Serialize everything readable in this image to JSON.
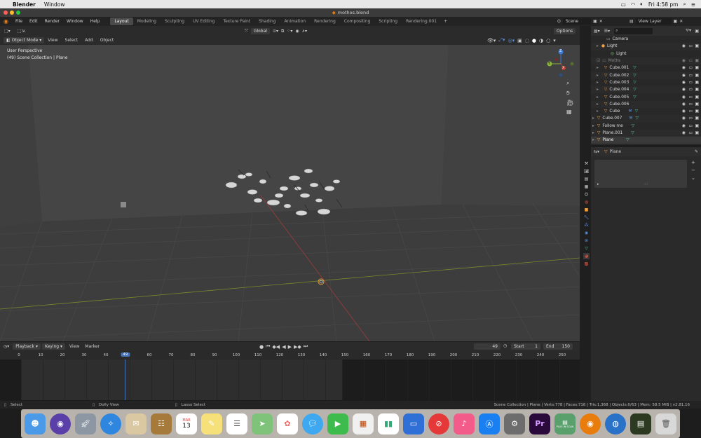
{
  "mac": {
    "apple_glyph": "",
    "app_name": "Blender",
    "menu_window": "Window",
    "clock": "Fri 4:58 pm"
  },
  "window": {
    "title": "mothos.blend"
  },
  "topbar": {
    "menus": [
      "File",
      "Edit",
      "Render",
      "Window",
      "Help"
    ],
    "workspaces": [
      "Layout",
      "Modeling",
      "Sculpting",
      "UV Editing",
      "Texture Paint",
      "Shading",
      "Animation",
      "Rendering",
      "Compositing",
      "Scripting",
      "Rendering.001"
    ],
    "active_workspace": "Layout",
    "scene": "Scene",
    "view_layer": "View Layer"
  },
  "toolheader": {
    "orientation": "Global",
    "options": "Options"
  },
  "viewport_header": {
    "mode": "Object Mode",
    "menus": [
      "View",
      "Select",
      "Add",
      "Object"
    ]
  },
  "viewport": {
    "perspective_label": "User Perspective",
    "collection_label": "(49) Scene Collection | Plane",
    "gizmo": {
      "x": "X",
      "y": "Y",
      "z": "Z"
    }
  },
  "outliner": {
    "rows": [
      "Camera",
      "Light",
      "Light",
      "Moths",
      "Cube.001",
      "Cube.002",
      "Cube.003",
      "Cube.004",
      "Cube.005",
      "Cube.006",
      "Cube",
      "Cube.007",
      "Follow me",
      "Plane.001",
      "Plane"
    ]
  },
  "properties": {
    "object_name": "Plane"
  },
  "timeline": {
    "menus": [
      "Playback",
      "Keying",
      "View",
      "Marker"
    ],
    "current_frame": "49",
    "start_label": "Start",
    "start": "1",
    "end_label": "End",
    "end": "150",
    "ruler_ticks": [
      "0",
      "10",
      "20",
      "30",
      "40",
      "49",
      "60",
      "70",
      "80",
      "90",
      "100",
      "110",
      "120",
      "130",
      "140",
      "150",
      "160",
      "170",
      "180",
      "190",
      "200",
      "210",
      "220",
      "230",
      "240",
      "250"
    ]
  },
  "statusbar": {
    "select": "Select",
    "dolly": "Dolly View",
    "lasso": "Lasso Select",
    "stats": "Scene Collection | Plane | Verts:778 | Faces:716 | Tris:1,368 | Objects:0/63 | Mem: 58.5 MiB | v2.81.16"
  },
  "dock": {
    "calendar_month": "MAR",
    "calendar_day": "13",
    "premiere": "Pr",
    "scan_label": "PLUS IN SCAN"
  },
  "colors": {
    "accent": "#4772b3",
    "x_axis": "#c0392b",
    "y_axis": "#8ab33a",
    "z_axis": "#3a7ad8",
    "background": "#3d3d3d"
  }
}
